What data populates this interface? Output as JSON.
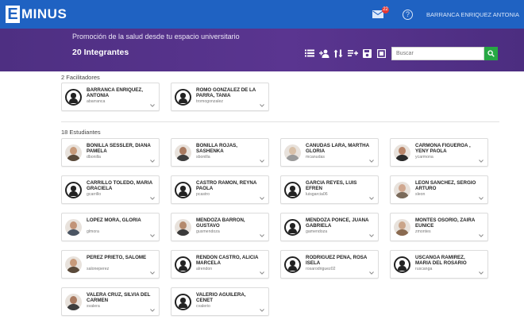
{
  "app": {
    "logo_letter": "E",
    "logo_text": "MINUS"
  },
  "topbar": {
    "mail_badge": "22",
    "help": "?",
    "user_name": "BARRANCA ENRIQUEZ ANTONIA"
  },
  "header": {
    "course_title": "Promoción de la salud desde tu espacio universitario",
    "members_count": "20 Integrantes",
    "search_placeholder": "Buscar"
  },
  "facilitators": {
    "label": "2 Facilitadores",
    "people": [
      {
        "name": "BARRANCA ENRIQUEZ, ANTONIA",
        "username": "abarranca",
        "avatar": "icon"
      },
      {
        "name": "ROMO GONZALEZ DE LA PARRA, TANIA",
        "username": "tromogonzalez",
        "avatar": "icon"
      }
    ]
  },
  "students": {
    "label": "18 Estudiantes",
    "people": [
      {
        "name": "BONILLA SESSLER, DIANA PAMELA",
        "username": "dbonilla",
        "avatar": "photo"
      },
      {
        "name": "BONILLA ROJAS, SASHENKA",
        "username": "sbonilla",
        "avatar": "photo"
      },
      {
        "name": "CANUDAS LARA, MARTHA GLORIA",
        "username": "mcanudas",
        "avatar": "photo"
      },
      {
        "name": "CARMONA FIGUEROA , YENY PAOLA",
        "username": "ycarmona",
        "avatar": "photo"
      },
      {
        "name": "CARRILLO TOLEDO, MARIA GRACIELA",
        "username": "gcarrillo",
        "avatar": "icon"
      },
      {
        "name": "CASTRO RAMON, REYNA PAOLA",
        "username": "pcastro",
        "avatar": "icon"
      },
      {
        "name": "GARCIA REYES, LUIS EFREN",
        "username": "luisgarcia06",
        "avatar": "icon"
      },
      {
        "name": "LEON SANCHEZ, SERGIO ARTURO",
        "username": "sleon",
        "avatar": "photo"
      },
      {
        "name": "LOPEZ MORA, GLORIA",
        "username": "glmora",
        "avatar": "photo"
      },
      {
        "name": "MENDOZA BARRON, GUSTAVO",
        "username": "gusmendoza",
        "avatar": "photo"
      },
      {
        "name": "MENDOZA PONCE, JUANA GABRIELA",
        "username": "gamendoza",
        "avatar": "icon"
      },
      {
        "name": "MONTES OSORIO, ZAIRA EUNICE",
        "username": "zmontes",
        "avatar": "photo"
      },
      {
        "name": "PEREZ PRIETO, SALOME",
        "username": "saloneperez",
        "avatar": "photo"
      },
      {
        "name": "RENDON CASTRO, ALICIA MARCELA",
        "username": "alrendon",
        "avatar": "icon"
      },
      {
        "name": "RODRIGUEZ PENA, ROSA ISELA",
        "username": "rosarodriguez02",
        "avatar": "icon"
      },
      {
        "name": "USCANGA RAMIREZ, MARIA DEL ROSARIO",
        "username": "ruscanga",
        "avatar": "icon"
      },
      {
        "name": "VALERA CRUZ, SILVIA DEL CARMEN",
        "username": "svalera",
        "avatar": "photo"
      },
      {
        "name": "VALERIO AGUILERA, CENET",
        "username": "cvalerio",
        "avatar": "icon"
      }
    ]
  }
}
